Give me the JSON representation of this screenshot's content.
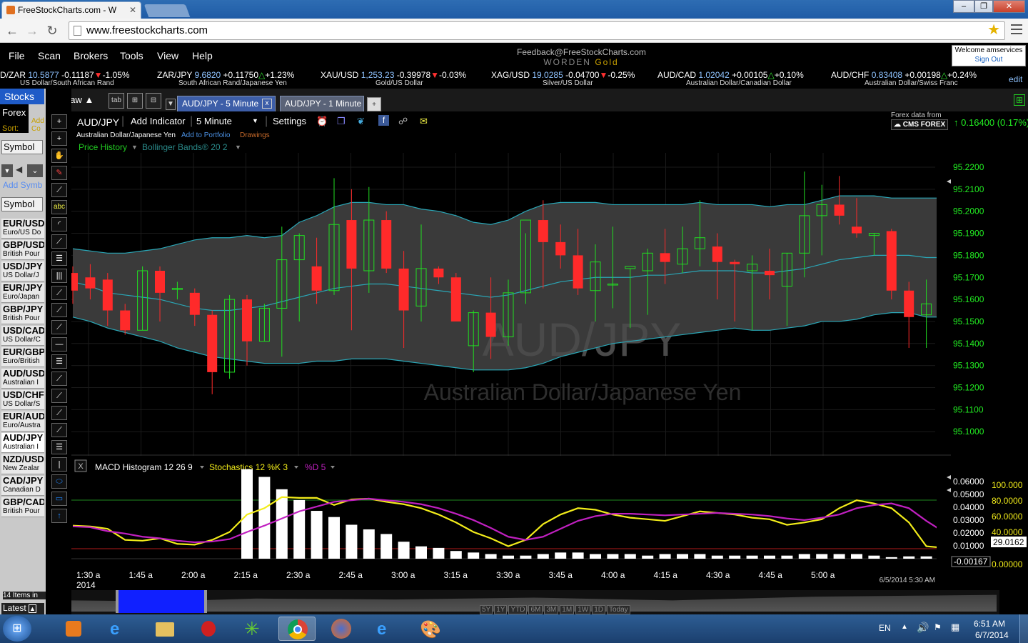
{
  "browser": {
    "tab_title": "FreeStockCharts.com - W",
    "url": "www.freestockcharts.com",
    "min_label": "–",
    "max_label": "❐",
    "close_label": "✕"
  },
  "menu": {
    "items": [
      "File",
      "Scan",
      "Brokers",
      "Tools",
      "View",
      "Help"
    ],
    "feedback": "Feedback@FreeStockCharts.com",
    "worden": "WORDEN",
    "gold": "Gold",
    "welcome": "Welcome amservices",
    "signout": "Sign Out"
  },
  "ticker": [
    {
      "sym": "D/ZAR",
      "price": "10.5877",
      "chg": "-0.11187",
      "pct": "-1.05%",
      "dir": "dn",
      "desc": "US Dollar/South African Rand"
    },
    {
      "sym": "ZAR/JPY",
      "price": "9.6820",
      "chg": "+0.11750",
      "pct": "+1.23%",
      "dir": "up",
      "desc": "South African Rand/Japanese Yen"
    },
    {
      "sym": "XAU/USD",
      "price": "1,253.23",
      "chg": "-0.39978",
      "pct": "-0.03%",
      "dir": "dn",
      "desc": "Gold/US Dollar"
    },
    {
      "sym": "XAG/USD",
      "price": "19.0285",
      "chg": "-0.04700",
      "pct": "-0.25%",
      "dir": "dn",
      "desc": "Silver/US Dollar"
    },
    {
      "sym": "AUD/CAD",
      "price": "1.02042",
      "chg": "+0.00105",
      "pct": "+0.10%",
      "dir": "up",
      "desc": "Australian Dollar/Canadian Dollar"
    },
    {
      "sym": "AUD/CHF",
      "price": "0.83408",
      "chg": "+0.00198",
      "pct": "+0.24%",
      "dir": "up",
      "desc": "Australian Dollar/Swiss Franc"
    }
  ],
  "ticker_edit": "edit",
  "left": {
    "stocks_tab": "Stocks",
    "forex": "Forex",
    "sort": "Sort:",
    "add": "Add Co",
    "symbol_header": "Symbol",
    "add_symbol": "Add Symb",
    "symbol_header2": "Symbol",
    "items_count": "14 Items in",
    "latest": "Latest",
    "symbols": [
      {
        "s": "EUR/USD",
        "d": "Euro/US Do"
      },
      {
        "s": "GBP/USD",
        "d": "British Pour"
      },
      {
        "s": "USD/JPY",
        "d": "US Dollar/J"
      },
      {
        "s": "EUR/JPY",
        "d": "Euro/Japan"
      },
      {
        "s": "GBP/JPY",
        "d": "British Pour"
      },
      {
        "s": "USD/CAD",
        "d": "US Dollar/C"
      },
      {
        "s": "EUR/GBP",
        "d": "Euro/British"
      },
      {
        "s": "AUD/USD",
        "d": "Australian I"
      },
      {
        "s": "USD/CHF",
        "d": "US Dollar/S"
      },
      {
        "s": "EUR/AUD",
        "d": "Euro/Austra"
      },
      {
        "s": "AUD/JPY",
        "d": "Australian I"
      },
      {
        "s": "NZD/USD",
        "d": "New Zealar"
      },
      {
        "s": "CAD/JPY",
        "d": "Canadian D"
      },
      {
        "s": "GBP/CAD",
        "d": "British Pour"
      }
    ]
  },
  "chart_tabs": {
    "draw": "Draw",
    "tab_btn": "tab",
    "tab1": "AUD/JPY - 5 Minute",
    "tab1_close": "x",
    "tab2": "AUD/JPY - 1 Minute"
  },
  "chart_head": {
    "symbol": "AUD/JPY",
    "add_indicator": "Add Indicator",
    "interval": "5 Minute",
    "settings": "Settings",
    "desc": "Australian Dollar/Japanese Yen",
    "add_portfolio": "Add to Portfolio",
    "drawings": "Drawings",
    "price_history": "Price History",
    "bollinger": "Bollinger Bands® 20 2",
    "forex_from": "Forex data from",
    "cms": "CMS FOREX",
    "last_change": "0.16400 (0.17%)"
  },
  "watermark": {
    "sym": "AUD/JPY",
    "name": "Australian Dollar/Japanese Yen"
  },
  "lower_head": {
    "close_x": "X",
    "macd": "MACD Histogram 12 26 9",
    "stoch": "Stochastics 12 %K 3",
    "pctd": "%D 5"
  },
  "axis": {
    "date_label": "2014",
    "timestamp": "6/5/2014 5:30 AM"
  },
  "ranges": [
    "5Y",
    "1Y",
    "YTD",
    "6M",
    "3M",
    "1M",
    "1W",
    "1D",
    "Today"
  ],
  "taskbar": {
    "lang": "EN",
    "time": "6:51 AM",
    "date": "6/7/2014"
  },
  "colors": {
    "up": "#22dd22",
    "down": "#ff2a2a",
    "band": "#2aa7b7",
    "stoch_k": "#f2ec1a",
    "stoch_d": "#c020c0",
    "axis_text": "#22ee22"
  },
  "chart_data": [
    {
      "type": "candlestick",
      "title": "AUD/JPY",
      "x_labels": [
        "1:30 a",
        "1:45 a",
        "2:00 a",
        "2:15 a",
        "2:30 a",
        "2:45 a",
        "3:00 a",
        "3:15 a",
        "3:30 a",
        "3:45 a",
        "4:00 a",
        "4:15 a",
        "4:30 a",
        "4:45 a",
        "5:00 a"
      ],
      "y_ticks": [
        95.22,
        95.21,
        95.2,
        95.19,
        95.18,
        95.17,
        95.16,
        95.15,
        95.14,
        95.13,
        95.12,
        95.11,
        95.1
      ],
      "ylim": [
        95.095,
        95.225
      ],
      "grid": true,
      "candles": [
        [
          95.172,
          95.175,
          95.158,
          95.164
        ],
        [
          95.17,
          95.176,
          95.16,
          95.165
        ],
        [
          95.169,
          95.172,
          95.148,
          95.155
        ],
        [
          95.155,
          95.158,
          95.144,
          95.146
        ],
        [
          95.146,
          95.175,
          95.146,
          95.173
        ],
        [
          95.173,
          95.175,
          95.15,
          95.163
        ],
        [
          95.165,
          95.168,
          95.16,
          95.165
        ],
        [
          95.163,
          95.165,
          95.148,
          95.153
        ],
        [
          95.153,
          95.155,
          95.117,
          95.127
        ],
        [
          95.127,
          95.162,
          95.124,
          95.16
        ],
        [
          95.16,
          95.162,
          95.13,
          95.141
        ],
        [
          95.141,
          95.158,
          95.141,
          95.156
        ],
        [
          95.156,
          95.193,
          95.134,
          95.178
        ],
        [
          95.178,
          95.19,
          95.15,
          95.189
        ],
        [
          95.175,
          95.188,
          95.158,
          95.164
        ],
        [
          95.164,
          95.215,
          95.162,
          95.194
        ],
        [
          95.196,
          95.21,
          95.146,
          95.174
        ],
        [
          95.173,
          95.211,
          95.163,
          95.196
        ],
        [
          95.196,
          95.2,
          95.172,
          95.174
        ],
        [
          95.174,
          95.182,
          95.138,
          95.155
        ],
        [
          95.157,
          95.194,
          95.15,
          95.174
        ],
        [
          95.174,
          95.175,
          95.167,
          95.17
        ],
        [
          95.17,
          95.172,
          95.151,
          95.15
        ],
        [
          95.139,
          95.155,
          95.127,
          95.154
        ],
        [
          95.154,
          95.17,
          95.133,
          95.143
        ],
        [
          95.143,
          95.169,
          95.139,
          95.163
        ],
        [
          95.163,
          95.19,
          95.158,
          95.196
        ],
        [
          95.196,
          95.205,
          95.165,
          95.186
        ],
        [
          95.186,
          95.194,
          95.174,
          95.18
        ],
        [
          95.18,
          95.192,
          95.162,
          95.165
        ],
        [
          95.164,
          95.185,
          95.15,
          95.177
        ],
        [
          95.167,
          95.193,
          95.156,
          95.167
        ],
        [
          95.174,
          95.174,
          95.147,
          95.175
        ],
        [
          95.173,
          95.183,
          95.153,
          95.181
        ],
        [
          95.181,
          95.192,
          95.167,
          95.177
        ],
        [
          95.176,
          95.193,
          95.172,
          95.183
        ],
        [
          95.183,
          95.205,
          95.175,
          95.188
        ],
        [
          95.184,
          95.19,
          95.16,
          95.177
        ],
        [
          95.177,
          95.178,
          95.15,
          95.176
        ],
        [
          95.173,
          95.18,
          95.146,
          95.176
        ],
        [
          95.173,
          95.183,
          95.16,
          95.171
        ],
        [
          95.166,
          95.181,
          95.148,
          95.181
        ],
        [
          95.181,
          95.218,
          95.17,
          95.198
        ],
        [
          95.198,
          95.212,
          95.18,
          95.203
        ],
        [
          95.203,
          95.216,
          95.194,
          95.198
        ],
        [
          95.193,
          95.206,
          95.188,
          95.19
        ],
        [
          95.189,
          95.19,
          95.18,
          95.19
        ],
        [
          95.191,
          95.192,
          95.16,
          95.164
        ],
        [
          95.164,
          95.168,
          95.138,
          95.152
        ],
        [
          95.153,
          95.169,
          95.138,
          95.158
        ],
        [
          95.159,
          95.172,
          95.153,
          95.16
        ],
        [
          95.16,
          95.178,
          95.155,
          95.175
        ]
      ],
      "band_upper": [
        95.183,
        95.182,
        95.181,
        95.181,
        95.182,
        95.183,
        95.185,
        95.187,
        95.188,
        95.188,
        95.189,
        95.188,
        95.189,
        95.195,
        95.198,
        95.202,
        95.204,
        95.204,
        95.203,
        95.203,
        95.201,
        95.2,
        95.198,
        95.195,
        95.194,
        95.196,
        95.2,
        95.203,
        95.204,
        95.204,
        95.204,
        95.203,
        95.203,
        95.203,
        95.203,
        95.203,
        95.204,
        95.203,
        95.203,
        95.203,
        95.202,
        95.203,
        95.203,
        95.205,
        95.207,
        95.207,
        95.207,
        95.206,
        95.206,
        95.206,
        95.206,
        95.205
      ],
      "band_mid": [
        95.168,
        95.166,
        95.163,
        95.162,
        95.161,
        95.16,
        95.158,
        95.156,
        95.155,
        95.155,
        95.156,
        95.157,
        95.159,
        95.161,
        95.163,
        95.165,
        95.166,
        95.167,
        95.167,
        95.166,
        95.165,
        95.164,
        95.163,
        95.162,
        95.161,
        95.162,
        95.164,
        95.166,
        95.168,
        95.169,
        95.17,
        95.17,
        95.17,
        95.171,
        95.171,
        95.172,
        95.173,
        95.173,
        95.173,
        95.172,
        95.172,
        95.173,
        95.174,
        95.176,
        95.178,
        95.179,
        95.18,
        95.18,
        95.18,
        95.179,
        95.179,
        95.179
      ],
      "band_lower": [
        95.152,
        95.15,
        95.147,
        95.145,
        95.143,
        95.141,
        95.138,
        95.136,
        95.134,
        95.133,
        95.132,
        95.131,
        95.131,
        95.131,
        95.132,
        95.132,
        95.133,
        95.133,
        95.133,
        95.132,
        95.131,
        95.13,
        95.129,
        95.128,
        95.128,
        95.128,
        95.129,
        95.131,
        95.134,
        95.136,
        95.138,
        95.14,
        95.141,
        95.142,
        95.143,
        95.144,
        95.145,
        95.146,
        95.147,
        95.146,
        95.146,
        95.147,
        95.148,
        95.15,
        95.15,
        95.151,
        95.153,
        95.154,
        95.154,
        95.152,
        95.152,
        95.153
      ]
    },
    {
      "type": "bar",
      "title": "MACD Histogram 12 26 9",
      "y_ticks": [
        0.06,
        0.05,
        0.04,
        0.03,
        0.02,
        0.01,
        -0.00167
      ],
      "ylim": [
        -0.004,
        0.064
      ],
      "values": [
        0,
        0,
        0,
        0,
        0,
        0,
        0,
        0,
        0,
        0,
        0.058,
        0.053,
        0.045,
        0.038,
        0.031,
        0.027,
        0.022,
        0.019,
        0.016,
        0.011,
        0.008,
        0.007,
        0.005,
        0.004,
        0.003,
        0.002,
        0.002,
        0.003,
        0.004,
        0.004,
        0.003,
        0.003,
        0.003,
        0.002,
        0.003,
        0.003,
        0.003,
        0.002,
        0.002,
        0.002,
        0.002,
        0.002,
        0.003,
        0.003,
        0.003,
        0.003,
        0.002,
        0.001,
        0.0015,
        0.0015,
        0.0015,
        0.002
      ]
    },
    {
      "type": "line",
      "title": "Stochastics 12 %K 3 / %D 5",
      "y_ticks": [
        100,
        80,
        60,
        40,
        20,
        0
      ],
      "ylim": [
        -5,
        110
      ],
      "current_value": "29.0162",
      "tick_100": "100.000",
      "tick_80": "80.0000",
      "tick_60": "60.0000",
      "tick_40": "40.0000",
      "tick_0": "0.00000",
      "series": [
        {
          "name": "%K",
          "values": [
            48,
            47,
            44,
            30,
            29,
            32,
            25,
            24,
            30,
            40,
            62,
            70,
            84,
            83,
            83,
            74,
            81,
            82,
            78,
            75,
            70,
            62,
            52,
            40,
            32,
            22,
            30,
            50,
            62,
            70,
            68,
            62,
            58,
            56,
            54,
            60,
            66,
            64,
            62,
            58,
            56,
            49,
            52,
            56,
            70,
            80,
            76,
            70,
            52,
            22,
            20,
            31
          ]
        },
        {
          "name": "%D",
          "values": [
            47,
            46,
            41,
            38,
            34,
            32,
            29,
            27,
            28,
            31,
            40,
            48,
            57,
            66,
            72,
            78,
            80,
            82,
            80,
            78,
            75,
            70,
            63,
            55,
            45,
            34,
            30,
            34,
            44,
            54,
            60,
            63,
            63,
            62,
            61,
            62,
            63,
            64,
            63,
            62,
            60,
            57,
            55,
            58,
            62,
            70,
            74,
            76,
            70,
            54,
            40,
            29
          ]
        }
      ]
    }
  ]
}
